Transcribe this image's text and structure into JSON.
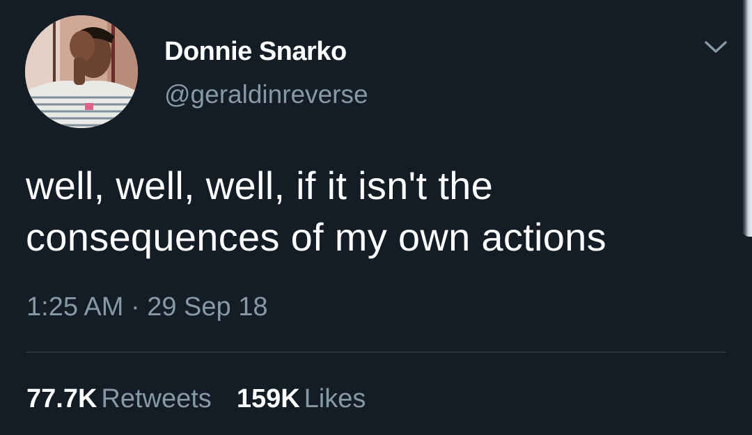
{
  "tweet": {
    "author": {
      "display_name": "Donnie Snarko",
      "handle": "@geraldinreverse",
      "avatar_icon": "avatar-photo"
    },
    "menu_icon": "chevron-down-icon",
    "text_lines": [
      "well, well, well, if it isn't the",
      "consequences of my own actions"
    ],
    "time": "1:25 AM",
    "separator": "·",
    "date": "29 Sep 18",
    "stats": {
      "retweets_count": "77.7K",
      "retweets_label": "Retweets",
      "likes_count": "159K",
      "likes_label": "Likes"
    }
  },
  "colors": {
    "background": "#141d26",
    "primary_text": "#ffffff",
    "secondary_text": "#8899a6",
    "divider": "#2a3540"
  }
}
